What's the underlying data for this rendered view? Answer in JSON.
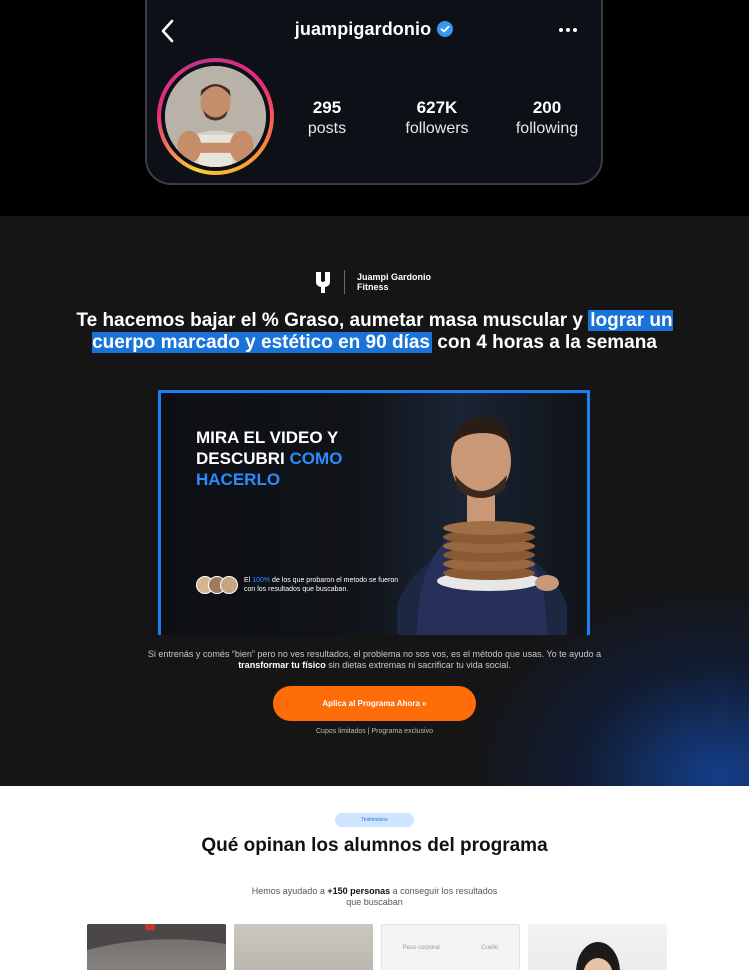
{
  "instagram": {
    "username": "juampigardonio",
    "stats": [
      {
        "value": "295",
        "label": "posts"
      },
      {
        "value": "627K",
        "label": "followers"
      },
      {
        "value": "200",
        "label": "following"
      }
    ],
    "colors": {
      "verified": "#3897f0",
      "background": "#0d1017"
    }
  },
  "brand": {
    "line1": "Juampi Gardonio",
    "line2": "Fitness"
  },
  "hero": {
    "headline_start": "Te hacemos bajar el % Graso, aumetar masa muscular y",
    "headline_highlight": "lograr un cuerpo marcado y estético en 90 días",
    "headline_end": "con 4 horas a la semana",
    "video": {
      "title_line1": "MIRA EL VIDEO Y",
      "title_line2_a": "DESCUBRI",
      "title_line2_b": "COMO",
      "title_line3": "HACERLO",
      "proof_a": "El",
      "proof_pct": "100%",
      "proof_b": "de los que probaron el metodo se fueron con los resultados que buscaban."
    },
    "description_a": "Si entrenás y comés “bien” pero no ves resultados, el problema no sos vos, es el método que usas. Yo te ayudo a",
    "description_bold": "transformar tu físico",
    "description_b": "sin dietas extremas ni sacrificar tu vida social.",
    "cta_label": "Aplica al Programa Ahora »",
    "cta_note": "Cupos limitados | Programa exclusivo",
    "colors": {
      "accent": "#1a73d9",
      "cta": "#ff6c0a",
      "background": "#151515"
    }
  },
  "testimonials": {
    "pill": "Testimonios",
    "title": "Qué opinan los alumnos del programa",
    "sub_a": "Hemos ayudado a",
    "sub_bold": "+150 personas",
    "sub_b": "a conseguir los resultados que buscaban",
    "thumb3_labels": [
      "Peso corporal",
      "Cuello"
    ]
  }
}
